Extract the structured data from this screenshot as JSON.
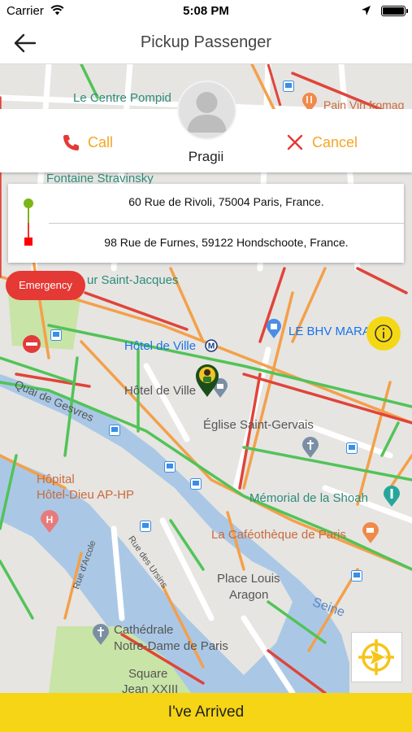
{
  "status_bar": {
    "carrier": "Carrier",
    "time": "5:08 PM"
  },
  "nav": {
    "title": "Pickup Passenger"
  },
  "actions": {
    "call_label": "Call",
    "cancel_label": "Cancel"
  },
  "passenger": {
    "name": "Pragii"
  },
  "route": {
    "pickup_address": "60 Rue de Rivoli, 75004 Paris, France.",
    "dropoff_address": "98 Rue de Furnes, 59122 Hondschoote, France."
  },
  "map": {
    "labels": {
      "centre_pompidou": "Le Centre Pompid",
      "pain_vin": "Pain Vin fromag",
      "fontaine": "Fontaine Stravinsky",
      "saint_jacques": "ur Saint-Jacques",
      "bhv": "LE BHV MARA",
      "hotel_de_ville_metro": "Hôtel de Ville",
      "hotel_de_ville": "Hôtel de Ville",
      "quai": "Quai de Gesvres",
      "eglise": "Église Saint-Gervais",
      "hopital_1": "Hôpital",
      "hopital_2": "Hôtel-Dieu AP-HP",
      "memorial": "Mémorial de la Shoah",
      "cafeotheque": "La Caféothèque de Paris",
      "rue_arcole": "Rue d'Arcole",
      "rue_ursins": "Rue des Ursins",
      "place_louis_1": "Place Louis",
      "place_louis_2": "Aragon",
      "seine": "Seine",
      "cathedrale_1": "Cathédrale",
      "cathedrale_2": "Notre-Dame de Paris",
      "square_1": "Square",
      "square_2": "Jean XXIII"
    }
  },
  "buttons": {
    "emergency": "Emergency",
    "arrived": "I've Arrived"
  },
  "colors": {
    "accent": "#f5a623",
    "arrived_bar": "#f5d515",
    "emergency": "#e53935",
    "pickup_dot": "#7cb518",
    "dropoff_dot": "#ff0000"
  }
}
